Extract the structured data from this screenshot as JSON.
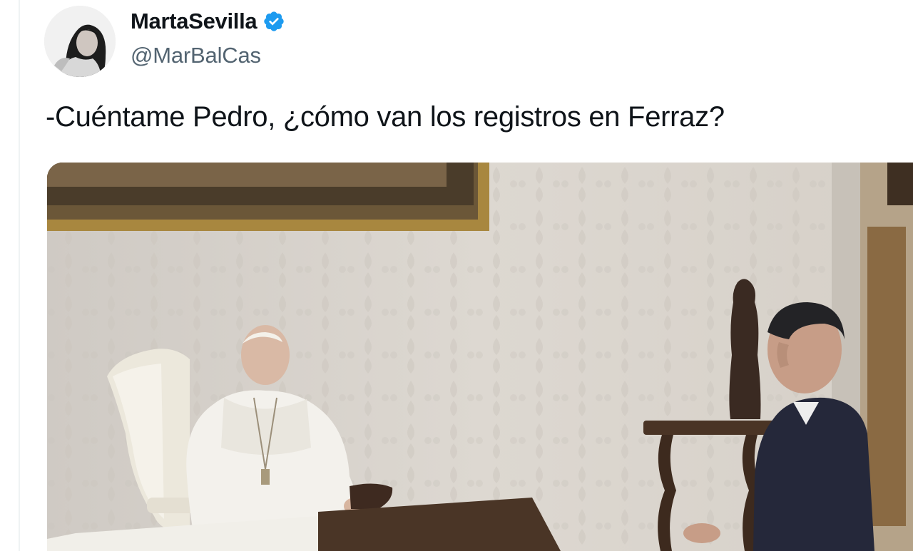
{
  "tweet": {
    "author": {
      "display_name": "MartaSevilla",
      "handle": "@MarBalCas",
      "verified": true,
      "avatar_icon": "profile-photo"
    },
    "text": "-Cuéntame Pedro, ¿cómo van los registros en Ferraz?",
    "media": {
      "type": "photo",
      "icon": "embedded-photo"
    }
  },
  "colors": {
    "text_primary": "#0f1419",
    "text_secondary": "#536471",
    "verified_badge": "#1d9bf0",
    "divider": "#eff3f4"
  }
}
